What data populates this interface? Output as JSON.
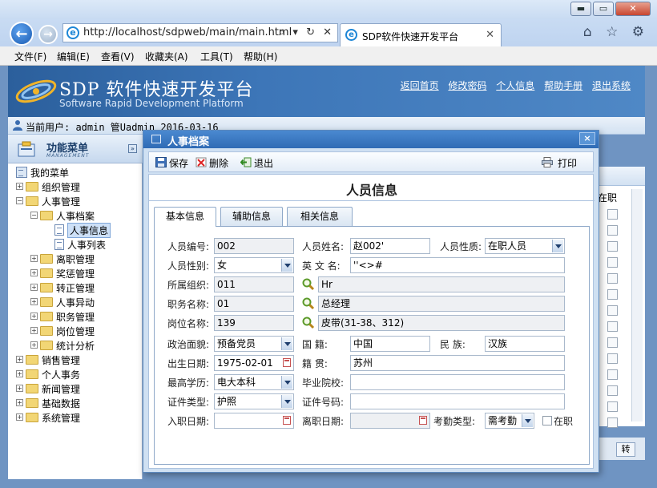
{
  "browser": {
    "url": "http://localhost/sdpweb/main/main.html",
    "address_tools": "⌕ ▾ ↻ ✕",
    "tab_title": "SDP软件快速开发平台",
    "tab_close": "✕",
    "back_glyph": "←",
    "forward_glyph": "→",
    "ie_glyph": "e",
    "window_buttons": [
      "▬",
      "▭",
      "✕"
    ],
    "right_icons": "⌂ ☆ ⚙",
    "menu": [
      "文件(F)",
      "编辑(E)",
      "查看(V)",
      "收藏夹(A)",
      "工具(T)",
      "帮助(H)"
    ]
  },
  "app": {
    "logo_title": "SDP 软件快速开发平台",
    "logo_subtitle": "Software Rapid Development Platform",
    "top_nav": [
      "返回首页",
      "修改密码",
      "个人信息",
      "帮助手册",
      "退出系统"
    ],
    "user_bar": "当前用户: admin 管Uadmin 2016-03-16"
  },
  "sidebar": {
    "title": "功能菜单",
    "subtitle": "MANAGEMENT",
    "collapse_glyph": "»",
    "tree": [
      {
        "label": "我的菜单",
        "level": 0,
        "type": "root"
      },
      {
        "label": "组织管理",
        "level": 1,
        "type": "folder",
        "exp": "+"
      },
      {
        "label": "人事管理",
        "level": 1,
        "type": "folder",
        "exp": "−"
      },
      {
        "label": "人事档案",
        "level": 2,
        "type": "folder",
        "exp": "−"
      },
      {
        "label": "人事信息",
        "level": 3,
        "type": "doc",
        "selected": true
      },
      {
        "label": "人事列表",
        "level": 3,
        "type": "doc"
      },
      {
        "label": "离职管理",
        "level": 2,
        "type": "folder",
        "exp": "+"
      },
      {
        "label": "奖惩管理",
        "level": 2,
        "type": "folder",
        "exp": "+"
      },
      {
        "label": "转正管理",
        "level": 2,
        "type": "folder",
        "exp": "+"
      },
      {
        "label": "人事异动",
        "level": 2,
        "type": "folder",
        "exp": "+"
      },
      {
        "label": "职务管理",
        "level": 2,
        "type": "folder",
        "exp": "+"
      },
      {
        "label": "岗位管理",
        "level": 2,
        "type": "folder",
        "exp": "+"
      },
      {
        "label": "统计分析",
        "level": 2,
        "type": "folder",
        "exp": "+"
      },
      {
        "label": "销售管理",
        "level": 1,
        "type": "folder",
        "exp": "+"
      },
      {
        "label": "个人事务",
        "level": 1,
        "type": "folder",
        "exp": "+"
      },
      {
        "label": "新闻管理",
        "level": 1,
        "type": "folder",
        "exp": "+"
      },
      {
        "label": "基础数据",
        "level": 1,
        "type": "folder",
        "exp": "+"
      },
      {
        "label": "系统管理",
        "level": 1,
        "type": "folder",
        "exp": "+"
      }
    ]
  },
  "background": {
    "column_header": "在职",
    "turn_button": "转"
  },
  "modal": {
    "title": "人事档案",
    "close_glyph": "×",
    "toolbar": {
      "save": "保存",
      "delete": "删除",
      "exit": "退出",
      "print": "打印"
    },
    "form_title": "人员信息",
    "tabs": [
      "基本信息",
      "辅助信息",
      "相关信息"
    ],
    "fields": {
      "emp_no_label": "人员编号:",
      "emp_no": "002",
      "name_label": "人员姓名:",
      "name": "赵002'",
      "nature_label": "人员性质:",
      "nature": "在职人员",
      "gender_label": "人员性别:",
      "gender": "女",
      "en_name_label": "英 文 名:",
      "en_name": "''<>#",
      "org_label": "所属组织:",
      "org_code": "011",
      "org_name": "Hr",
      "duty_label": "职务名称:",
      "duty_code": "01",
      "duty_name": "总经理",
      "post_label": "岗位名称:",
      "post_code": "139",
      "post_name": "皮带(31-38、312)",
      "politics_label": "政治面貌:",
      "politics": "预备党员",
      "nationality_label": "国 籍:",
      "nationality": "中国",
      "ethnic_label": "民 族:",
      "ethnic": "汉族",
      "birth_label": "出生日期:",
      "birth": "1975-02-01",
      "native_label": "籍 贯:",
      "native": "苏州",
      "edu_label": "最高学历:",
      "edu": "电大本科",
      "school_label": "毕业院校:",
      "school": "",
      "cert_type_label": "证件类型:",
      "cert_type": "护照",
      "cert_no_label": "证件号码:",
      "cert_no": "",
      "join_label": "入职日期:",
      "join": "",
      "leave_label": "离职日期:",
      "leave": "",
      "attend_label": "考勤类型:",
      "attend": "需考勤",
      "onjob_label": "在职"
    }
  }
}
